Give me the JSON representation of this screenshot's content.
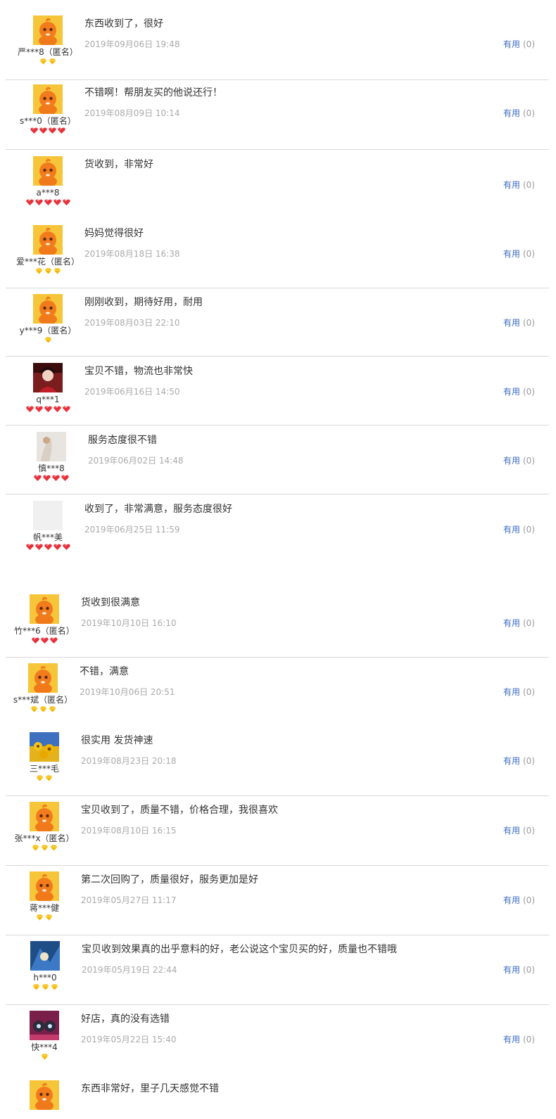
{
  "icons": {
    "default_avatar": "taobao-doll-avatar-icon",
    "level_diamond": "yellow-diamond-icon",
    "level_heart": "red-heart-icon"
  },
  "colors": {
    "useful_link": "#3b6bc1",
    "date_text": "#aaaaaa",
    "diamond": "#f5b800",
    "heart": "#e8303a"
  },
  "reviews": [
    {
      "user": "严***8（匿名）",
      "avatar": "default",
      "level_type": "diamond",
      "level_count": 2,
      "content": "东西收到了，很好",
      "date": "2019年09月06日 19:48",
      "useful_label": "有用",
      "useful_count": "(0)"
    },
    {
      "user": "s***0（匿名）",
      "avatar": "default",
      "level_type": "heart",
      "level_count": 4,
      "content": "不错啊！帮朋友买的他说还行！",
      "date": "2019年08月09日 10:14",
      "useful_label": "有用",
      "useful_count": "(0)"
    },
    {
      "user": "a***8",
      "avatar": "default",
      "level_type": "heart",
      "level_count": 5,
      "content": "货收到，非常好",
      "date": "",
      "useful_label": "有用",
      "useful_count": "(0)"
    },
    {
      "user": "爱***花（匿名）",
      "avatar": "default",
      "level_type": "diamond",
      "level_count": 3,
      "content": "妈妈觉得很好",
      "date": "2019年08月18日 16:38",
      "useful_label": "有用",
      "useful_count": "(0)"
    },
    {
      "user": "y***9（匿名）",
      "avatar": "default",
      "level_type": "diamond",
      "level_count": 1,
      "content": "刚刚收到，期待好用，耐用",
      "date": "2019年08月03日 22:10",
      "useful_label": "有用",
      "useful_count": "(0)"
    },
    {
      "user": "q***1",
      "avatar": "photo-portrait",
      "level_type": "heart",
      "level_count": 5,
      "content": "宝贝不错，物流也非常快",
      "date": "2019年06月16日 14:50",
      "useful_label": "有用",
      "useful_count": "(0)"
    },
    {
      "user": "慎***8",
      "avatar": "photo-light",
      "level_type": "heart",
      "level_count": 4,
      "content": "服务态度很不错",
      "date": "2019年06月02日 14:48",
      "useful_label": "有用",
      "useful_count": "(0)"
    },
    {
      "user": "帆***美",
      "avatar": "photo-blank",
      "level_type": "heart",
      "level_count": 5,
      "content": "收到了，非常满意，服务态度很好",
      "date": "2019年06月25日 11:59",
      "useful_label": "有用",
      "useful_count": "(0)"
    },
    {
      "user": "竹***6（匿名）",
      "avatar": "default",
      "level_type": "heart",
      "level_count": 3,
      "content": "货收到很满意",
      "date": "2019年10月10日 16:10",
      "useful_label": "有用",
      "useful_count": "(0)"
    },
    {
      "user": "s***斌（匿名）",
      "avatar": "default",
      "level_type": "diamond",
      "level_count": 3,
      "content": "不错，满意",
      "date": "2019年10月06日 20:51",
      "useful_label": "有用",
      "useful_count": "(0)"
    },
    {
      "user": "三***毛",
      "avatar": "photo-flowers",
      "level_type": "diamond",
      "level_count": 2,
      "content": "很实用 发货神速",
      "date": "2019年08月23日 20:18",
      "useful_label": "有用",
      "useful_count": "(0)"
    },
    {
      "user": "张***x（匿名）",
      "avatar": "default",
      "level_type": "diamond",
      "level_count": 3,
      "content": "宝贝收到了，质量不错，价格合理，我很喜欢",
      "date": "2019年08月10日 16:15",
      "useful_label": "有用",
      "useful_count": "(0)"
    },
    {
      "user": "蒋***健",
      "avatar": "default",
      "level_type": "diamond",
      "level_count": 2,
      "content": "第二次回购了，质量很好，服务更加是好",
      "date": "2019年05月27日 11:17",
      "useful_label": "有用",
      "useful_count": "(0)"
    },
    {
      "user": "h***0",
      "avatar": "photo-blue",
      "level_type": "diamond",
      "level_count": 3,
      "content": "宝贝收到效果真的出乎意料的好，老公说这个宝贝买的好，质量也不错哦",
      "date": "2019年05月19日 22:44",
      "useful_label": "有用",
      "useful_count": "(0)"
    },
    {
      "user": "快***4",
      "avatar": "photo-mask",
      "level_type": "diamond",
      "level_count": 1,
      "content": "好店，真的没有选错",
      "date": "2019年05月22日 15:40",
      "useful_label": "有用",
      "useful_count": "(0)"
    },
    {
      "user": "",
      "avatar": "default",
      "level_type": "diamond",
      "level_count": 0,
      "content": "东西非常好，里子几天感觉不错",
      "date": "",
      "useful_label": "",
      "useful_count": ""
    }
  ]
}
